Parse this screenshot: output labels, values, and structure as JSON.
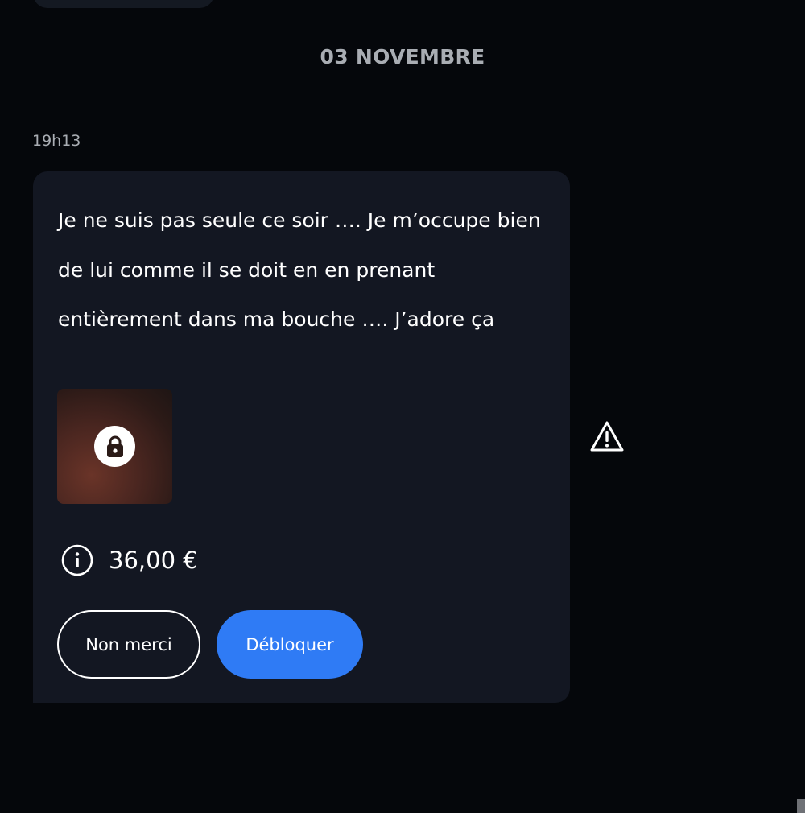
{
  "conversation": {
    "date_separator": "03 NOVEMBRE",
    "message": {
      "time": "19h13",
      "text": "Je ne suis pas seule ce soir …. Je m’occupe bien de lui comme il se doit en en prenant entièrement dans ma bouche …. J’adore ça",
      "attachment": {
        "icon": "lock-icon",
        "locked": true
      },
      "price": "36,00 €",
      "buttons": {
        "decline_label": "Non merci",
        "unlock_label": "Débloquer"
      },
      "report_icon": "warning-triangle-icon"
    }
  },
  "colors": {
    "background": "#05070b",
    "bubble": "#131722",
    "accent": "#2f7bf5",
    "muted_text": "#a9adb3"
  }
}
